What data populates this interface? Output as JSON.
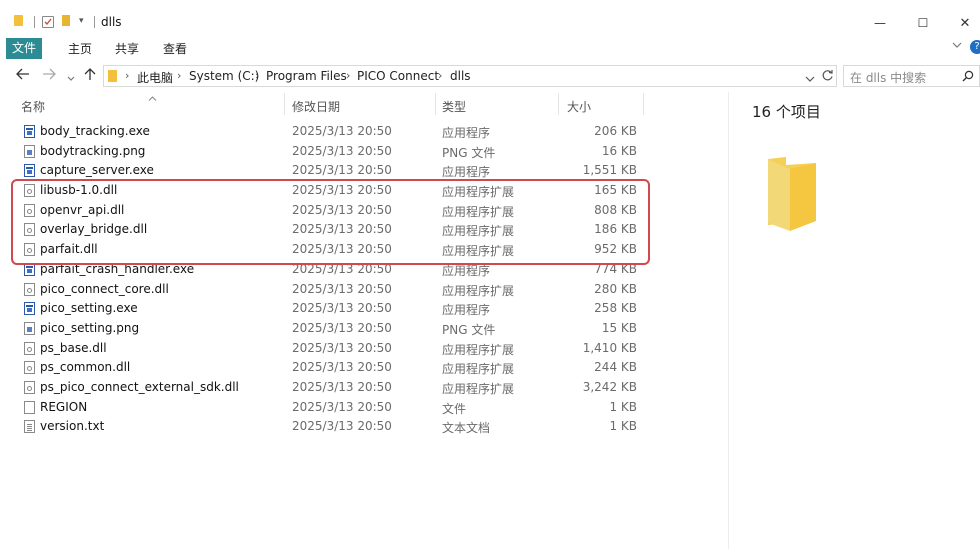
{
  "window": {
    "title": "dlls",
    "controls": {
      "minimize": "—",
      "maximize": "☐",
      "close": "✕"
    }
  },
  "ribbon": {
    "tabs": [
      {
        "label": "文件",
        "active": true
      },
      {
        "label": "主页",
        "active": false
      },
      {
        "label": "共享",
        "active": false
      },
      {
        "label": "查看",
        "active": false
      }
    ],
    "expand_icon": "chevron-down-icon",
    "help_icon": "?"
  },
  "address": {
    "breadcrumbs": [
      "此电脑",
      "System (C:)",
      "Program Files",
      "PICO Connect",
      "dlls"
    ]
  },
  "search": {
    "placeholder": "在 dlls 中搜索"
  },
  "columns": {
    "name": "名称",
    "date": "修改日期",
    "type": "类型",
    "size": "大小"
  },
  "files": [
    {
      "name": "body_tracking.exe",
      "date": "2025/3/13 20:50",
      "type": "应用程序",
      "size": "206 KB",
      "icon": "exe"
    },
    {
      "name": "bodytracking.png",
      "date": "2025/3/13 20:50",
      "type": "PNG 文件",
      "size": "16 KB",
      "icon": "png"
    },
    {
      "name": "capture_server.exe",
      "date": "2025/3/13 20:50",
      "type": "应用程序",
      "size": "1,551 KB",
      "icon": "exe"
    },
    {
      "name": "libusb-1.0.dll",
      "date": "2025/3/13 20:50",
      "type": "应用程序扩展",
      "size": "165 KB",
      "icon": "dll"
    },
    {
      "name": "openvr_api.dll",
      "date": "2025/3/13 20:50",
      "type": "应用程序扩展",
      "size": "808 KB",
      "icon": "dll"
    },
    {
      "name": "overlay_bridge.dll",
      "date": "2025/3/13 20:50",
      "type": "应用程序扩展",
      "size": "186 KB",
      "icon": "dll"
    },
    {
      "name": "parfait.dll",
      "date": "2025/3/13 20:50",
      "type": "应用程序扩展",
      "size": "952 KB",
      "icon": "dll"
    },
    {
      "name": "parfait_crash_handler.exe",
      "date": "2025/3/13 20:50",
      "type": "应用程序",
      "size": "774 KB",
      "icon": "exe"
    },
    {
      "name": "pico_connect_core.dll",
      "date": "2025/3/13 20:50",
      "type": "应用程序扩展",
      "size": "280 KB",
      "icon": "dll"
    },
    {
      "name": "pico_setting.exe",
      "date": "2025/3/13 20:50",
      "type": "应用程序",
      "size": "258 KB",
      "icon": "exe"
    },
    {
      "name": "pico_setting.png",
      "date": "2025/3/13 20:50",
      "type": "PNG 文件",
      "size": "15 KB",
      "icon": "png"
    },
    {
      "name": "ps_base.dll",
      "date": "2025/3/13 20:50",
      "type": "应用程序扩展",
      "size": "1,410 KB",
      "icon": "dll"
    },
    {
      "name": "ps_common.dll",
      "date": "2025/3/13 20:50",
      "type": "应用程序扩展",
      "size": "244 KB",
      "icon": "dll"
    },
    {
      "name": "ps_pico_connect_external_sdk.dll",
      "date": "2025/3/13 20:50",
      "type": "应用程序扩展",
      "size": "3,242 KB",
      "icon": "dll"
    },
    {
      "name": "REGION",
      "date": "2025/3/13 20:50",
      "type": "文件",
      "size": "1 KB",
      "icon": "file"
    },
    {
      "name": "version.txt",
      "date": "2025/3/13 20:50",
      "type": "文本文档",
      "size": "1 KB",
      "icon": "txt"
    }
  ],
  "preview": {
    "item_count": "16 个项目"
  },
  "colors": {
    "accent": "#2d8b94",
    "highlight": "#d1484e",
    "folder": "#f3c03b"
  }
}
